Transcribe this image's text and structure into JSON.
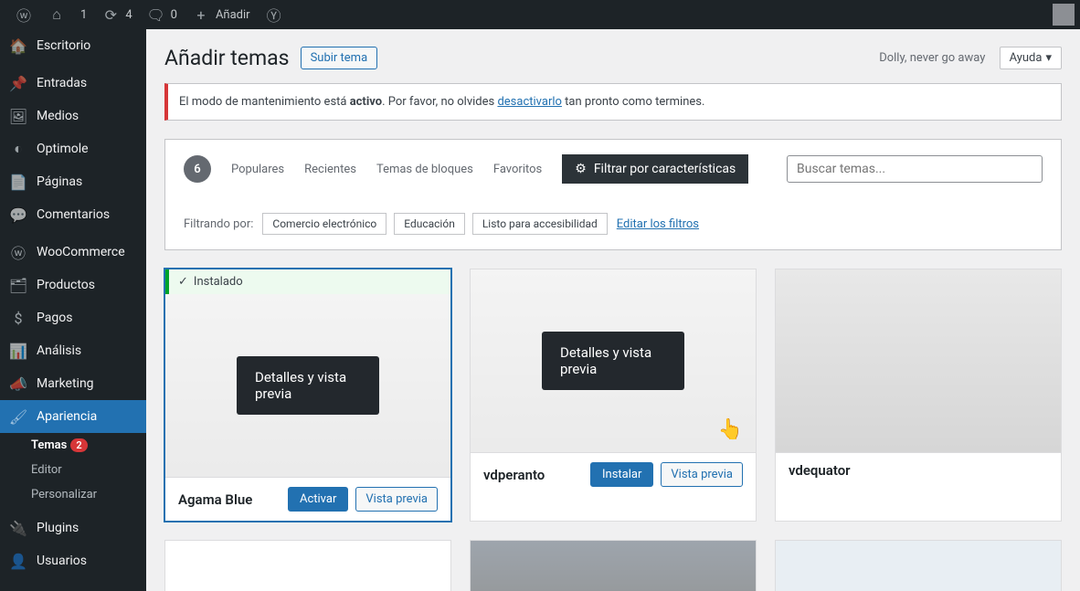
{
  "adminbar": {
    "site_num": "1",
    "updates": "4",
    "comments": "0",
    "add": "Añadir"
  },
  "menu": {
    "items": [
      {
        "icon": "dash",
        "label": "Escritorio"
      },
      {
        "icon": "pin",
        "label": "Entradas"
      },
      {
        "icon": "media",
        "label": "Medios"
      },
      {
        "icon": "opt",
        "label": "Optimole"
      },
      {
        "icon": "page",
        "label": "Páginas"
      },
      {
        "icon": "comm",
        "label": "Comentarios"
      },
      {
        "icon": "woo",
        "label": "WooCommerce"
      },
      {
        "icon": "prod",
        "label": "Productos"
      },
      {
        "icon": "pay",
        "label": "Pagos"
      },
      {
        "icon": "anal",
        "label": "Análisis"
      },
      {
        "icon": "mkt",
        "label": "Marketing"
      },
      {
        "icon": "appear",
        "label": "Apariencia",
        "current": true
      },
      {
        "icon": "plug",
        "label": "Plugins"
      },
      {
        "icon": "user",
        "label": "Usuarios"
      }
    ],
    "sub": [
      {
        "label": "Temas",
        "badge": "2",
        "current": true
      },
      {
        "label": "Editor"
      },
      {
        "label": "Personalizar"
      }
    ]
  },
  "header": {
    "title": "Añadir temas",
    "upload": "Subir tema",
    "hello": "Dolly, never go away",
    "help": "Ayuda"
  },
  "notice": {
    "pre": "El modo de mantenimiento está ",
    "strong": "activo",
    "mid": ". Por favor, no olvides ",
    "link": "desactivarlo",
    "post": " tan pronto como termines."
  },
  "filters": {
    "count": "6",
    "tabs": [
      "Populares",
      "Recientes",
      "Temas de bloques",
      "Favoritos"
    ],
    "feature_btn": "Filtrar por características",
    "search_placeholder": "Buscar temas...",
    "filtering_by": "Filtrando por:",
    "tags": [
      "Comercio electrónico",
      "Educación",
      "Listo para accesibilidad"
    ],
    "edit": "Editar los filtros"
  },
  "themes": {
    "details_label": "Detalles y vista previa",
    "installed_label": "Instalado",
    "list": [
      {
        "name": "Agama Blue",
        "installed": true,
        "active_outline": true,
        "btns": [
          {
            "t": "Activar",
            "p": true
          },
          {
            "t": "Vista previa"
          }
        ],
        "overlay": true
      },
      {
        "name": "vdperanto",
        "btns": [
          {
            "t": "Instalar",
            "p": true
          },
          {
            "t": "Vista previa"
          }
        ],
        "overlay": true,
        "hand": true
      },
      {
        "name": "vdequator"
      }
    ]
  }
}
